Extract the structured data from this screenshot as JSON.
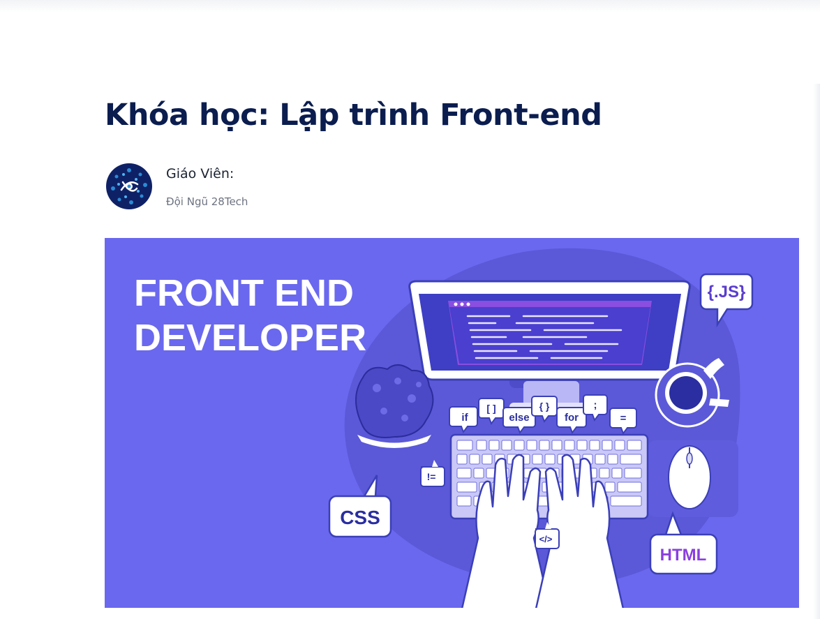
{
  "page": {
    "title": "Khóa học: Lập trình Front-end"
  },
  "teacher": {
    "label": "Giáo Viên:",
    "name": "Đội Ngũ 28Tech",
    "avatar_icon": "network-logo-icon"
  },
  "banner": {
    "headline_line1": "FRONT END",
    "headline_line2": "DEVELOPER",
    "bubbles": {
      "js": "{.JS}",
      "css": "CSS",
      "html": "HTML",
      "if": "if",
      "brackets": "[ ]",
      "else": "else",
      "braces": "{ }",
      "for": "for",
      "semicolon": ";",
      "equals": "=",
      "not_equals": "!=",
      "tag": "</>"
    },
    "colors": {
      "background": "#6a68ee",
      "dark": "#3b3fb8",
      "light": "#ffffff"
    }
  }
}
